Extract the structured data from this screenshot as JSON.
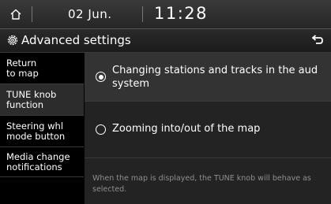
{
  "statusbar": {
    "home_icon": "home-icon",
    "date": "02 Jun.",
    "time": "11:28"
  },
  "header": {
    "settings_icon": "gear-icon",
    "title": "Advanced settings",
    "back_icon": "back-arrow-icon"
  },
  "sidebar": {
    "items": [
      {
        "label": "Return\nto map"
      },
      {
        "label": "TUNE knob\nfunction"
      },
      {
        "label": "Steering whl\nmode button"
      },
      {
        "label": "Media change\nnotifications"
      }
    ],
    "active_index": 1
  },
  "main": {
    "options": [
      {
        "label": "Changing stations and tracks in the aud",
        "label_line2": "system",
        "selected": true
      },
      {
        "label": "Zooming into/out of the map",
        "selected": false
      }
    ],
    "note": "When the map is displayed, the TUNE knob will behave as selected."
  }
}
